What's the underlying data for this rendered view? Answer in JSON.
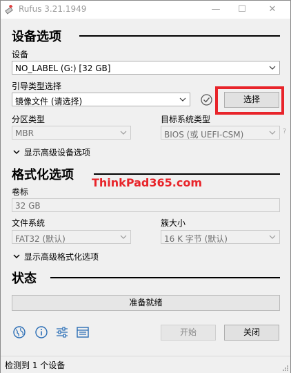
{
  "window": {
    "title": "Rufus 3.21.1949",
    "min": "—",
    "max": "☐",
    "close": "✕"
  },
  "device_section": {
    "heading": "设备选项",
    "device_label": "设备",
    "device_value": "NO_LABEL (G:) [32 GB]",
    "boot_label": "引导类型选择",
    "boot_value": "镜像文件 (请选择)",
    "select_button": "选择",
    "partition_label": "分区类型",
    "partition_value": "MBR",
    "target_label": "目标系统类型",
    "target_value": "BIOS (或 UEFI-CSM)",
    "help": "?",
    "advanced": "显示高级设备选项"
  },
  "format_section": {
    "heading": "格式化选项",
    "volume_label": "卷标",
    "volume_value": "32 GB",
    "fs_label": "文件系统",
    "fs_value": "FAT32 (默认)",
    "cluster_label": "簇大小",
    "cluster_value": "16 K 字节 (默认)",
    "advanced": "显示高级格式化选项"
  },
  "status_section": {
    "heading": "状态",
    "progress_text": "准备就绪"
  },
  "footer": {
    "icons": [
      "globe-icon",
      "info-icon",
      "settings-sliders-icon",
      "log-icon"
    ],
    "start": "开始",
    "close": "关闭"
  },
  "statusbar": {
    "text": "检测到 1 个设备"
  },
  "watermark": "ThinkPad365.com",
  "colors": {
    "highlight": "#e8242a",
    "accent": "#2a6db5"
  }
}
